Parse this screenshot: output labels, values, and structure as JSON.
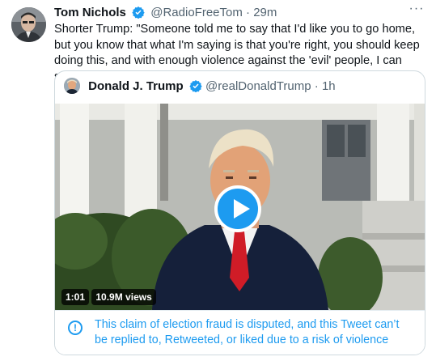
{
  "tweet": {
    "author_name": "Tom Nichols",
    "author_handle": "@RadioFreeTom",
    "separator": "·",
    "time": "29m",
    "more_label": "···",
    "text": "Shorter Trump: \"Someone told me to say that I'd like you to go home, but you know that what I'm saying is that you're right, you should keep doing this, and with enough violence against the 'evil' people, I can stay in office.\""
  },
  "quoted": {
    "author_name": "Donald J. Trump",
    "author_handle": "@realDonaldTrump",
    "separator": "·",
    "time": "1h",
    "video": {
      "duration": "1:01",
      "views": "10.9M views"
    },
    "notice": {
      "icon": "!",
      "text": "This claim of election fraud is disputed, and this Tweet can’t be replied to, Retweeted, or liked due to a risk of violence"
    }
  },
  "colors": {
    "accent": "#1d9bf0",
    "text": "#0f1419",
    "secondary": "#536471",
    "border": "#cfd9de"
  },
  "icons": [
    "verified-badge-icon",
    "more-icon",
    "play-icon",
    "info-icon"
  ]
}
